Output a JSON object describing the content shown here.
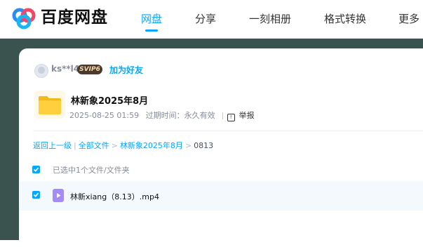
{
  "app": {
    "name": "百度网盘"
  },
  "nav": {
    "items": [
      {
        "label": "网盘",
        "active": true
      },
      {
        "label": "分享",
        "active": false
      },
      {
        "label": "一刻相册",
        "active": false
      },
      {
        "label": "格式转换",
        "active": false
      },
      {
        "label": "更多",
        "active": false
      }
    ]
  },
  "share": {
    "user": {
      "name": "ks**l4",
      "badge": "SVIP6",
      "add_friend_label": "加为好友"
    },
    "folder_icon": "folder-icon",
    "title": "林新象2025年8月",
    "date": "2025-08-25 01:59",
    "expiry_label": "过期时间：永久有效",
    "report_label": "举报"
  },
  "breadcrumb": {
    "items": [
      {
        "label": "返回上一级",
        "link": true
      },
      {
        "label": "全部文件",
        "link": true
      },
      {
        "label": "林新象2025年8月",
        "link": true
      },
      {
        "label": "0813",
        "link": false
      }
    ]
  },
  "selection": {
    "label": "已选中1个文件/文件夹",
    "checked": true
  },
  "files": [
    {
      "name": "林新xiang（8.13）.mp4",
      "icon": "video-file-icon",
      "checked": true
    }
  ],
  "colors": {
    "accent": "#06a7ff",
    "background": "#3b534e"
  }
}
